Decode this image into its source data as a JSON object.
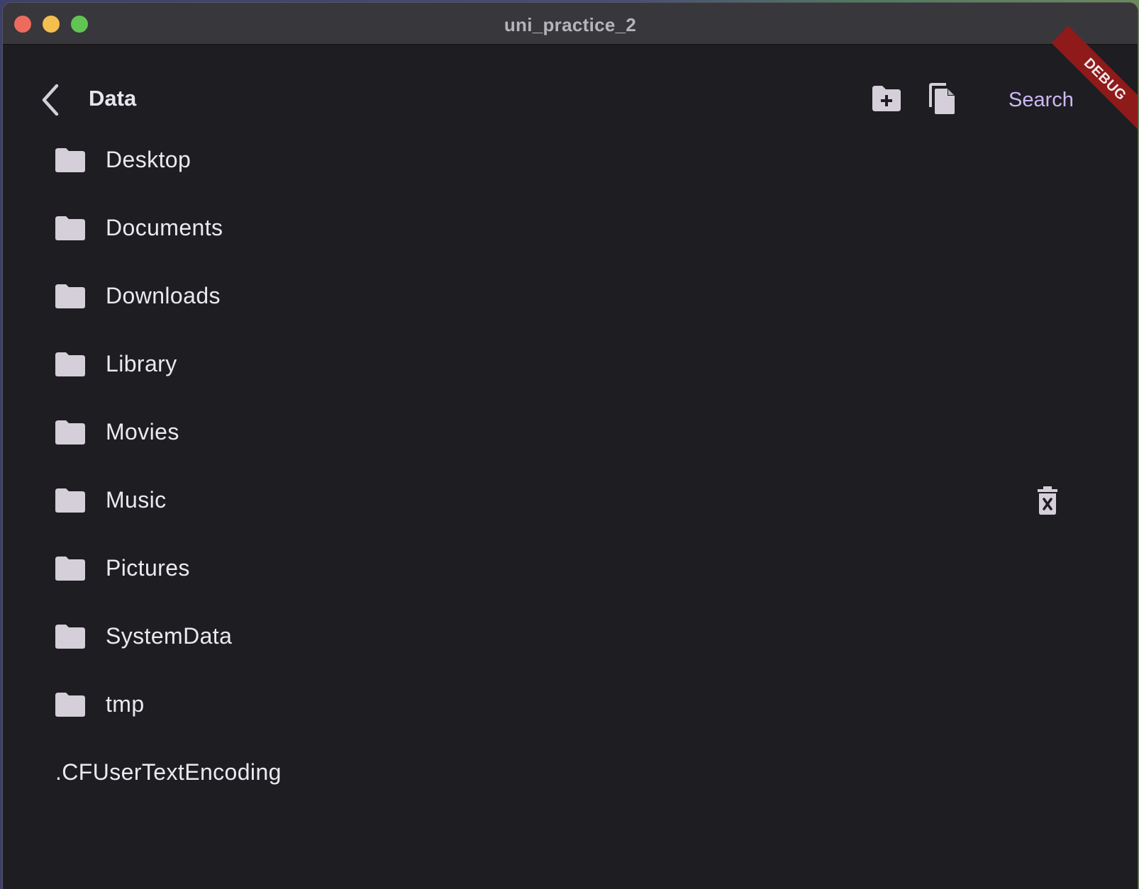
{
  "window": {
    "title": "uni_practice_2"
  },
  "app_bar": {
    "title": "Data",
    "back_icon": "chevron-left-icon",
    "new_folder_icon": "create-new-folder-icon",
    "copy_icon": "copy-file-icon",
    "search_label": "Search"
  },
  "debug_banner": {
    "label": "DEBUG"
  },
  "files": [
    {
      "name": "Desktop",
      "type": "folder"
    },
    {
      "name": "Documents",
      "type": "folder"
    },
    {
      "name": "Downloads",
      "type": "folder"
    },
    {
      "name": "Library",
      "type": "folder"
    },
    {
      "name": "Movies",
      "type": "folder"
    },
    {
      "name": "Music",
      "type": "folder",
      "action_icon": "delete-forever-icon"
    },
    {
      "name": "Pictures",
      "type": "folder"
    },
    {
      "name": "SystemData",
      "type": "folder"
    },
    {
      "name": "tmp",
      "type": "folder"
    },
    {
      "name": ".CFUserTextEncoding",
      "type": "file"
    }
  ],
  "colors": {
    "background": "#1e1d21",
    "titlebar": "#38373c",
    "accent": "#cdb8f5",
    "icon": "#d4cfd8",
    "debug": "#8f1a1a"
  }
}
